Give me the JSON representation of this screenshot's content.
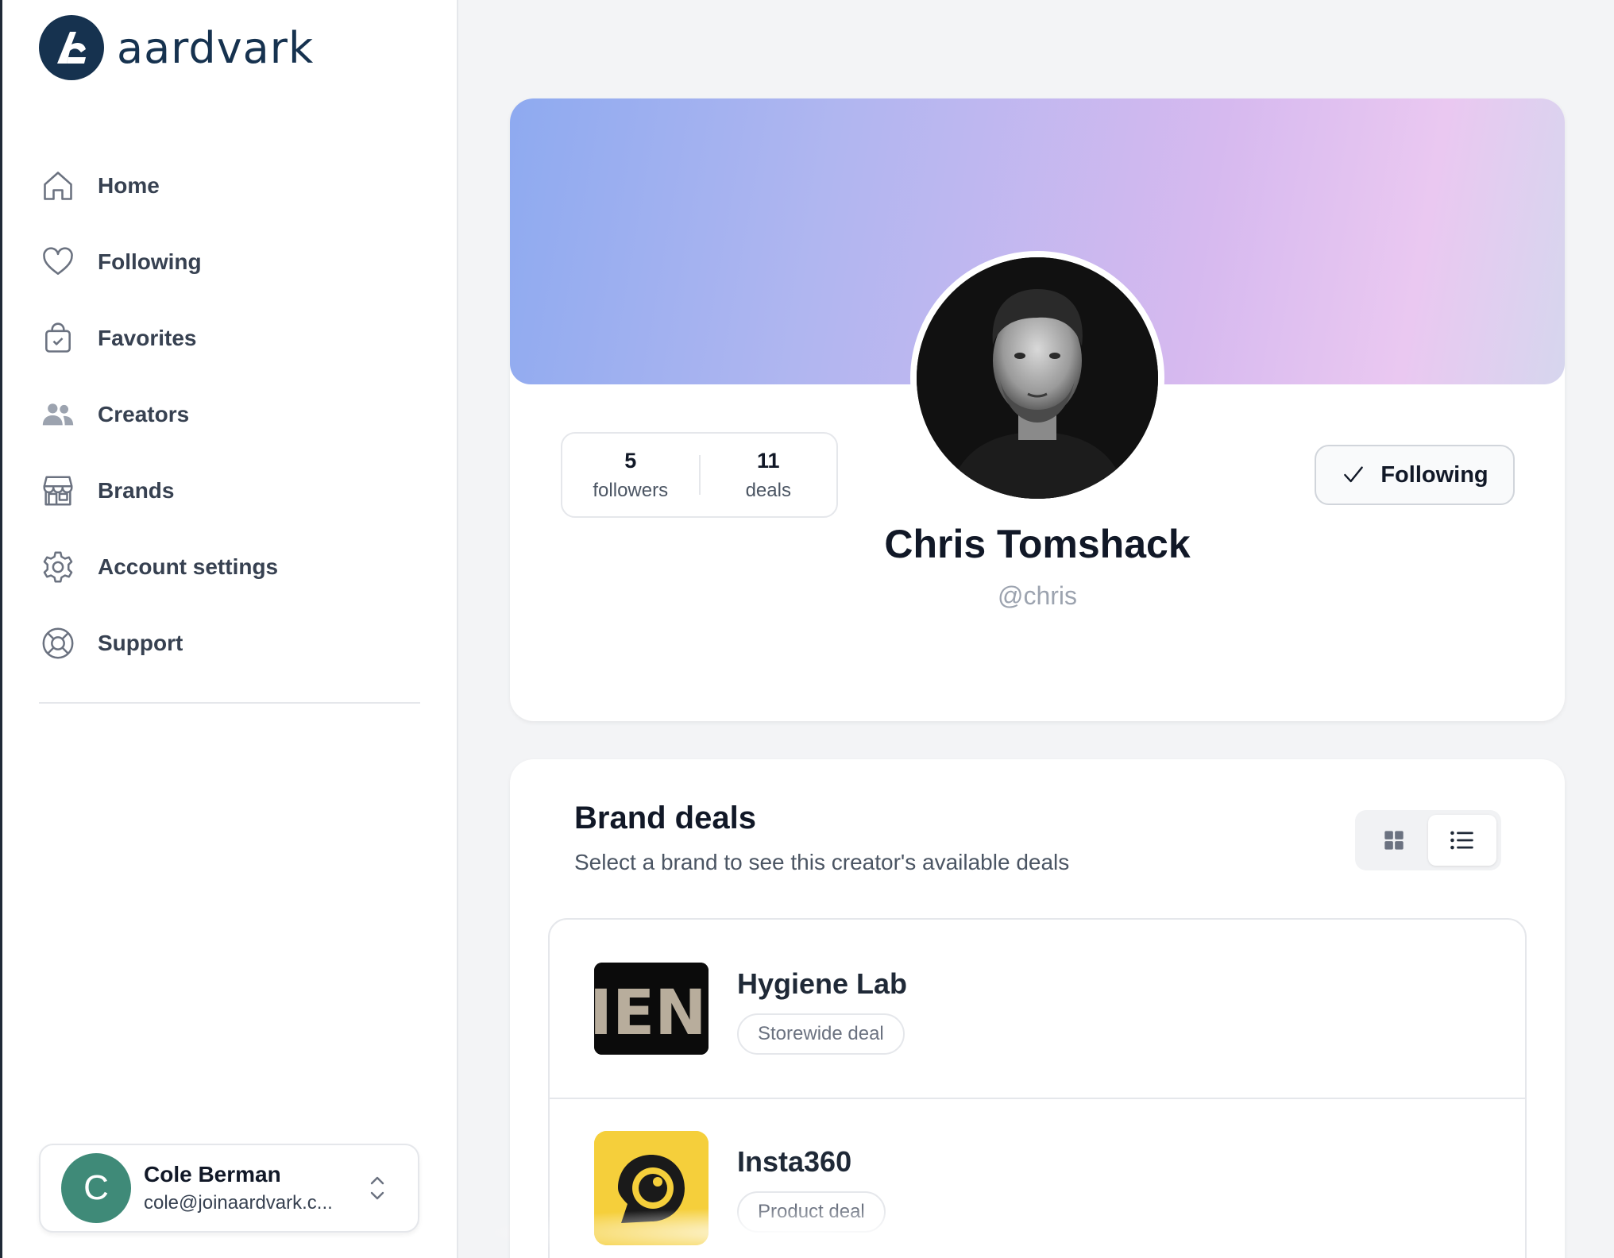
{
  "app": {
    "name": "aardvark"
  },
  "sidebar": {
    "items": [
      {
        "label": "Home",
        "icon": "home-icon"
      },
      {
        "label": "Following",
        "icon": "heart-icon"
      },
      {
        "label": "Favorites",
        "icon": "bag-check-icon"
      },
      {
        "label": "Creators",
        "icon": "users-icon"
      },
      {
        "label": "Brands",
        "icon": "storefront-icon"
      },
      {
        "label": "Account settings",
        "icon": "gear-icon"
      },
      {
        "label": "Support",
        "icon": "lifebuoy-icon"
      }
    ],
    "user": {
      "initial": "C",
      "name": "Cole Berman",
      "email": "cole@joinaardvark.c..."
    }
  },
  "profile": {
    "followers_count": "5",
    "followers_label": "followers",
    "deals_count": "11",
    "deals_label": "deals",
    "name": "Chris Tomshack",
    "handle": "@chris",
    "follow_button_label": "Following"
  },
  "brand_deals": {
    "title": "Brand deals",
    "subtitle": "Select a brand to see this creator's available deals",
    "view_modes": [
      "grid",
      "list"
    ],
    "active_view": "list",
    "deals": [
      {
        "brand": "Hygiene Lab",
        "type": "Storewide deal",
        "logo_text": "IENE"
      },
      {
        "brand": "Insta360",
        "type": "Product deal"
      }
    ]
  },
  "colors": {
    "brand": "#16324f",
    "avatar_bg": "#3f8a78",
    "insta360_yellow": "#f5cf3b"
  }
}
